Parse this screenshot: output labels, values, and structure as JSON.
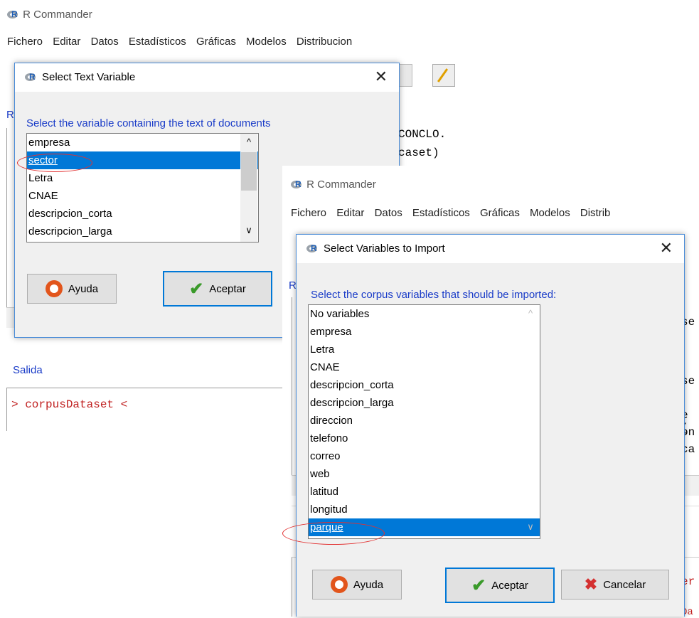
{
  "back_window": {
    "title": "R Commander",
    "menu": [
      "Fichero",
      "Editar",
      "Datos",
      "Estadísticos",
      "Gráficas",
      "Modelos",
      "Distribucion"
    ],
    "salida_label": "Salida",
    "frag_r": "R",
    "code_lines": [
      "CONCLO.",
      "caset)"
    ],
    "output_line": "> corpusDataset <"
  },
  "dialog1": {
    "title": "Select Text Variable",
    "prompt": "Select the variable containing the text of documents",
    "items": [
      "empresa",
      "sector",
      "Letra",
      "CNAE",
      "descripcion_corta",
      "descripcion_larga"
    ],
    "selected": "sector",
    "help_label": "Ayuda",
    "ok_label": "Aceptar"
  },
  "front_window": {
    "title": "R Commander",
    "menu": [
      "Fichero",
      "Editar",
      "Datos",
      "Estadísticos",
      "Gráficas",
      "Modelos",
      "Distrib"
    ],
    "frag_r": "R",
    "right_frags": [
      "se",
      "se",
      "e (",
      "on",
      "ca",
      "er",
      "Da"
    ]
  },
  "dialog2": {
    "title": "Select Variables to Import",
    "prompt": "Select the corpus variables that should be imported:",
    "items": [
      "No variables",
      "empresa",
      "Letra",
      "CNAE",
      "descripcion_corta",
      "descripcion_larga",
      "direccion",
      "telefono",
      "correo",
      "web",
      "latitud",
      "longitud",
      "parque"
    ],
    "selected": "parque",
    "help_label": "Ayuda",
    "ok_label": "Aceptar",
    "cancel_label": "Cancelar"
  },
  "colors": {
    "selection": "#0078d7",
    "prompt": "#1a3cc8",
    "highlight_oval": "#e23030",
    "focus_border": "#0078d7"
  },
  "icons": [
    "r-logo-icon",
    "close-icon",
    "help-lifebuoy-icon",
    "checkmark-icon",
    "cancel-x-icon",
    "scroll-up-icon",
    "scroll-down-icon"
  ]
}
